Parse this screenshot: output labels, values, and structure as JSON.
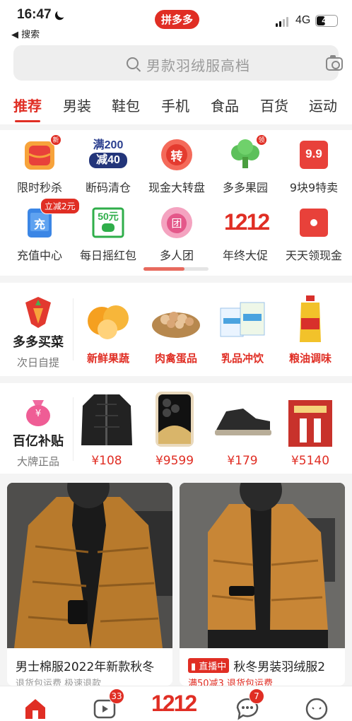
{
  "status": {
    "time": "16:47",
    "back_label": "◀ 搜索",
    "app_pill": "拼多多",
    "network": "4G",
    "battery": "43"
  },
  "search": {
    "placeholder": "男款羽绒服高档"
  },
  "tabs": [
    "推荐",
    "男装",
    "鞋包",
    "手机",
    "食品",
    "百货",
    "运动"
  ],
  "features": [
    {
      "label": "限时秒杀",
      "badge": "新"
    },
    {
      "label": "断码清仓",
      "icon_text_1": "满200",
      "icon_text_2": "减40"
    },
    {
      "label": "现金大转盘",
      "icon_text": "转"
    },
    {
      "label": "多多果园",
      "badge": "领"
    },
    {
      "label": "9块9特卖",
      "icon_text": "9.9"
    },
    {
      "label": "充值中心",
      "icon_text": "充",
      "badge": "立减2元"
    },
    {
      "label": "每日摇红包",
      "icon_text": "50元"
    },
    {
      "label": "多人团",
      "icon_text": "团"
    },
    {
      "label": "年终大促",
      "icon_text": "1212"
    },
    {
      "label": "天天领现金"
    }
  ],
  "grocery": {
    "title": "多多买菜",
    "sub": "次日自提",
    "items": [
      "新鲜果蔬",
      "肉禽蛋品",
      "乳品冲饮",
      "粮油调味"
    ]
  },
  "subsidy": {
    "title": "百亿补贴",
    "sub": "大牌正品",
    "icon_text": "¥",
    "prices": [
      "¥108",
      "¥9599",
      "¥179",
      "¥5140"
    ]
  },
  "cards": [
    {
      "title": "男士棉服2022年新款秋冬",
      "sub": "退货包运费  极速退款"
    },
    {
      "live": "直播中",
      "title": "秋冬男装羽绒服2",
      "sub": "满50减3  退货包运费"
    }
  ],
  "nav": [
    {
      "name": "首页",
      "badge": ""
    },
    {
      "name": "多多视频",
      "badge": "33"
    },
    {
      "name": "1212",
      "badge": ""
    },
    {
      "name": "聊天",
      "badge": "7"
    },
    {
      "name": "个人中心",
      "badge": ""
    }
  ],
  "colors": {
    "brand": "#e02e24"
  }
}
